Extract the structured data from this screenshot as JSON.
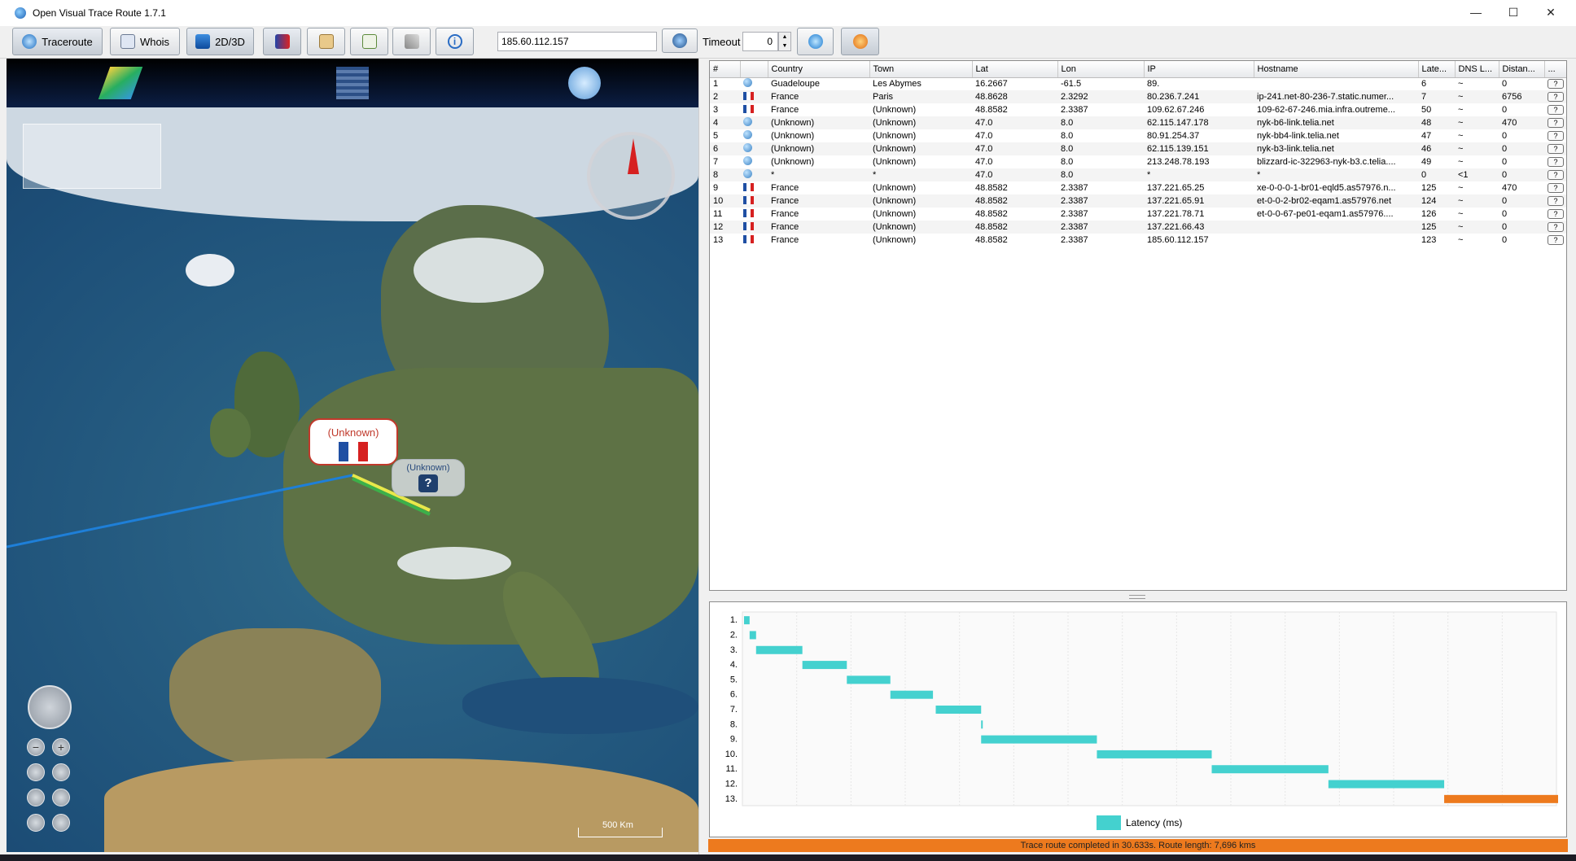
{
  "window": {
    "title": "Open Visual Trace Route 1.7.1",
    "minimize": "—",
    "maximize": "☐",
    "close": "✕"
  },
  "toolbar": {
    "traceroute_label": "Traceroute",
    "whois_label": "Whois",
    "mode_label": "2D/3D",
    "ip_value": "185.60.112.157",
    "timeout_label": "Timeout",
    "timeout_value": "0"
  },
  "map": {
    "bubble_primary": "(Unknown)",
    "bubble_secondary": "(Unknown)",
    "bubble_secondary_icon": "?",
    "scale_label": "500 Km",
    "zoom_in": "+",
    "zoom_out": "−"
  },
  "colors": {
    "route_line": "#1e7fd8",
    "route_active": "#e8e84a",
    "latency_bar": "#44d1cf",
    "last_bar": "#ed7a1e",
    "status_bg": "#ed7a1e"
  },
  "table": {
    "columns": [
      "#",
      "",
      "Country",
      "Town",
      "Lat",
      "Lon",
      "IP",
      "Hostname",
      "Late...",
      "DNS L...",
      "Distan...",
      "..."
    ],
    "rows": [
      {
        "n": "1",
        "icon": "unknown-icon",
        "country": "Guadeloupe",
        "town": "Les Abymes",
        "lat": "16.2667",
        "lon": "-61.5",
        "ip": "89.",
        "host": "",
        "lat_ms": "6",
        "dns": "~",
        "dist": "0"
      },
      {
        "n": "2",
        "icon": "flag-fr-icon",
        "country": "France",
        "town": "Paris",
        "lat": "48.8628",
        "lon": "2.3292",
        "ip": "80.236.7.241",
        "host": "ip-241.net-80-236-7.static.numer...",
        "lat_ms": "7",
        "dns": "~",
        "dist": "6756"
      },
      {
        "n": "3",
        "icon": "flag-fr-icon",
        "country": "France",
        "town": "(Unknown)",
        "lat": "48.8582",
        "lon": "2.3387",
        "ip": "109.62.67.246",
        "host": "109-62-67-246.mia.infra.outreme...",
        "lat_ms": "50",
        "dns": "~",
        "dist": "0"
      },
      {
        "n": "4",
        "icon": "unknown-icon",
        "country": "(Unknown)",
        "town": "(Unknown)",
        "lat": "47.0",
        "lon": "8.0",
        "ip": "62.115.147.178",
        "host": "nyk-b6-link.telia.net",
        "lat_ms": "48",
        "dns": "~",
        "dist": "470"
      },
      {
        "n": "5",
        "icon": "unknown-icon",
        "country": "(Unknown)",
        "town": "(Unknown)",
        "lat": "47.0",
        "lon": "8.0",
        "ip": "80.91.254.37",
        "host": "nyk-bb4-link.telia.net",
        "lat_ms": "47",
        "dns": "~",
        "dist": "0"
      },
      {
        "n": "6",
        "icon": "unknown-icon",
        "country": "(Unknown)",
        "town": "(Unknown)",
        "lat": "47.0",
        "lon": "8.0",
        "ip": "62.115.139.151",
        "host": "nyk-b3-link.telia.net",
        "lat_ms": "46",
        "dns": "~",
        "dist": "0"
      },
      {
        "n": "7",
        "icon": "unknown-icon",
        "country": "(Unknown)",
        "town": "(Unknown)",
        "lat": "47.0",
        "lon": "8.0",
        "ip": "213.248.78.193",
        "host": "blizzard-ic-322963-nyk-b3.c.telia....",
        "lat_ms": "49",
        "dns": "~",
        "dist": "0"
      },
      {
        "n": "8",
        "icon": "unknown-icon",
        "country": "*",
        "town": "*",
        "lat": "47.0",
        "lon": "8.0",
        "ip": "*",
        "host": "*",
        "lat_ms": "0",
        "dns": "<1",
        "dist": "0"
      },
      {
        "n": "9",
        "icon": "flag-fr-icon",
        "country": "France",
        "town": "(Unknown)",
        "lat": "48.8582",
        "lon": "2.3387",
        "ip": "137.221.65.25",
        "host": "xe-0-0-0-1-br01-eqld5.as57976.n...",
        "lat_ms": "125",
        "dns": "~",
        "dist": "470"
      },
      {
        "n": "10",
        "icon": "flag-fr-icon",
        "country": "France",
        "town": "(Unknown)",
        "lat": "48.8582",
        "lon": "2.3387",
        "ip": "137.221.65.91",
        "host": "et-0-0-2-br02-eqam1.as57976.net",
        "lat_ms": "124",
        "dns": "~",
        "dist": "0"
      },
      {
        "n": "11",
        "icon": "flag-fr-icon",
        "country": "France",
        "town": "(Unknown)",
        "lat": "48.8582",
        "lon": "2.3387",
        "ip": "137.221.78.71",
        "host": "et-0-0-67-pe01-eqam1.as57976....",
        "lat_ms": "126",
        "dns": "~",
        "dist": "0"
      },
      {
        "n": "12",
        "icon": "flag-fr-icon",
        "country": "France",
        "town": "(Unknown)",
        "lat": "48.8582",
        "lon": "2.3387",
        "ip": "137.221.66.43",
        "host": "",
        "lat_ms": "125",
        "dns": "~",
        "dist": "0"
      },
      {
        "n": "13",
        "icon": "flag-fr-icon",
        "country": "France",
        "town": "(Unknown)",
        "lat": "48.8582",
        "lon": "2.3387",
        "ip": "185.60.112.157",
        "host": "",
        "lat_ms": "123",
        "dns": "~",
        "dist": "0"
      }
    ]
  },
  "chart_data": {
    "type": "bar",
    "title": "",
    "legend": "Latency (ms)",
    "categories": [
      "1.",
      "2.",
      "3.",
      "4.",
      "5.",
      "6.",
      "7.",
      "8.",
      "9.",
      "10.",
      "11.",
      "12.",
      "13."
    ],
    "series": [
      {
        "name": "Latency (ms)",
        "start": [
          0,
          6,
          13,
          63,
          111,
          158,
          207,
          256,
          256,
          381,
          505,
          631,
          756
        ],
        "values": [
          6,
          7,
          50,
          48,
          47,
          46,
          49,
          0,
          125,
          124,
          126,
          125,
          123
        ]
      }
    ]
  },
  "status": {
    "text": "Trace route completed in 30.633s. Route length: 7,696 kms"
  }
}
